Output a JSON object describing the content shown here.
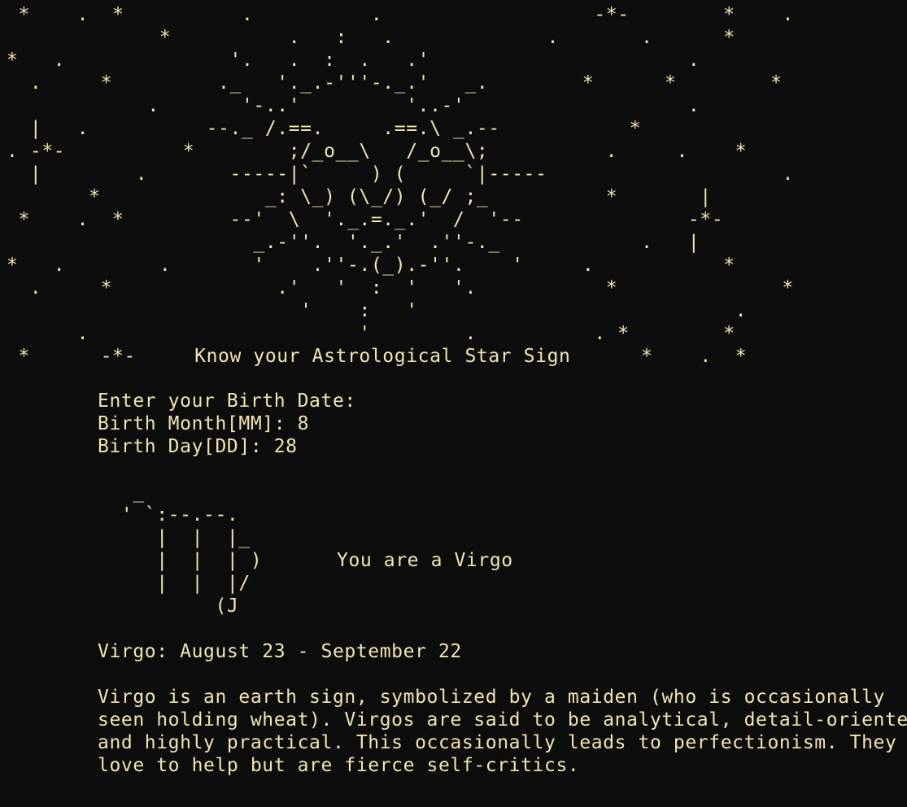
{
  "banner": {
    "art_lines": [
      " *    .  *          .          .                  -*-        *    .",
      "             *          .   :   .             .       .      *",
      "*   .              '.   .  :  .   .'                      .",
      "  .     *         ._   '._.-'''-._.'   _.        *      *        *",
      "            .       '-..'         '..-'                   .",
      "  |   .          --._ /.==.     .==.\\ _.--           *",
      ". -*-          *        ;/_o__\\   /_o__\\;          .     .    *",
      "  |        .       -----|`     ) (     `|-----                    .",
      "       *              _: \\_) (\\_/) (_/ ;_          *       |",
      " *    .  *         --'  \\  '._.=._.'  /  '--              -*-",
      "                     _.-''.  '._.'  .''-._            .   |",
      "*   .        .       '    .''-.(_).-''.    '     .           *",
      "  .     *              .'   '  :  '   '.           *              *",
      "                         '    :   '                           .",
      "      .                       '        .          . *        *"
    ],
    "title_line": " *      -*-     Know your Astrological Star Sign      *    .  *"
  },
  "prompts": {
    "heading": "Enter your Birth Date:",
    "month_label": "Birth Month[MM]: ",
    "month_value": "8",
    "day_label": "Birth Day[DD]: ",
    "day_value": "28"
  },
  "sign": {
    "art_lines": [
      "   _",
      "  ' `:--.--.",
      "     |  |  |_",
      "     |  |  | )",
      "     |  |  |/",
      "          (J"
    ],
    "result": "You are a Virgo"
  },
  "details": {
    "date_range": "Virgo: August 23 - September 22",
    "description_lines": [
      "Virgo is an earth sign, symbolized by a maiden (who is occasionally",
      "seen holding wheat). Virgos are said to be analytical, detail-oriented",
      "and highly practical. This occasionally leads to perfectionism. They",
      "love to help but are fierce self-critics."
    ]
  }
}
